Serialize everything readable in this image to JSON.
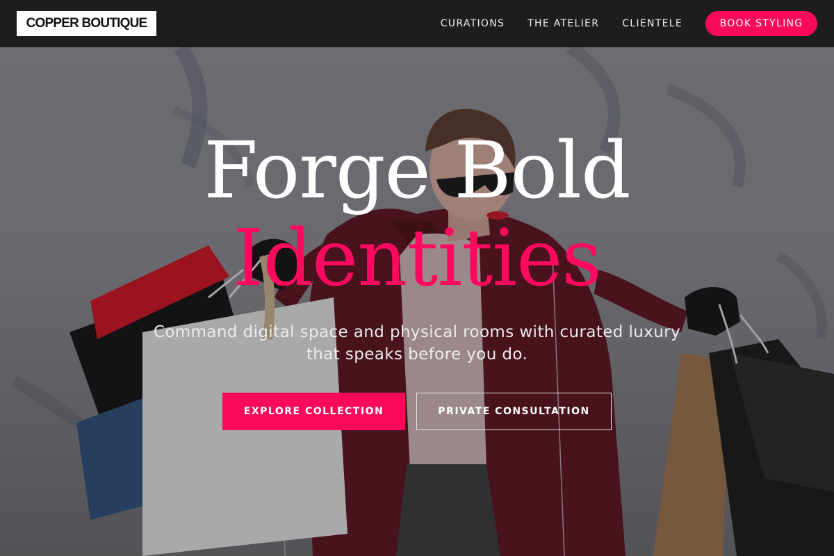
{
  "brand": {
    "logo_text": "COPPER BOUTIQUE"
  },
  "nav": {
    "links": [
      "CURATIONS",
      "THE ATELIER",
      "CLIENTELE"
    ],
    "cta": "BOOK STYLING"
  },
  "hero": {
    "title_line1": "Forge Bold",
    "title_line2": "Identities",
    "subtitle": "Command digital space and physical rooms with curated luxury that speaks before you do.",
    "primary_button": "EXPLORE COLLECTION",
    "secondary_button": "PRIVATE CONSULTATION"
  },
  "colors": {
    "accent": "#fb0a5c",
    "nav_background": "#1d1d1d"
  },
  "icons": [
    "hero-photo-shopper"
  ]
}
